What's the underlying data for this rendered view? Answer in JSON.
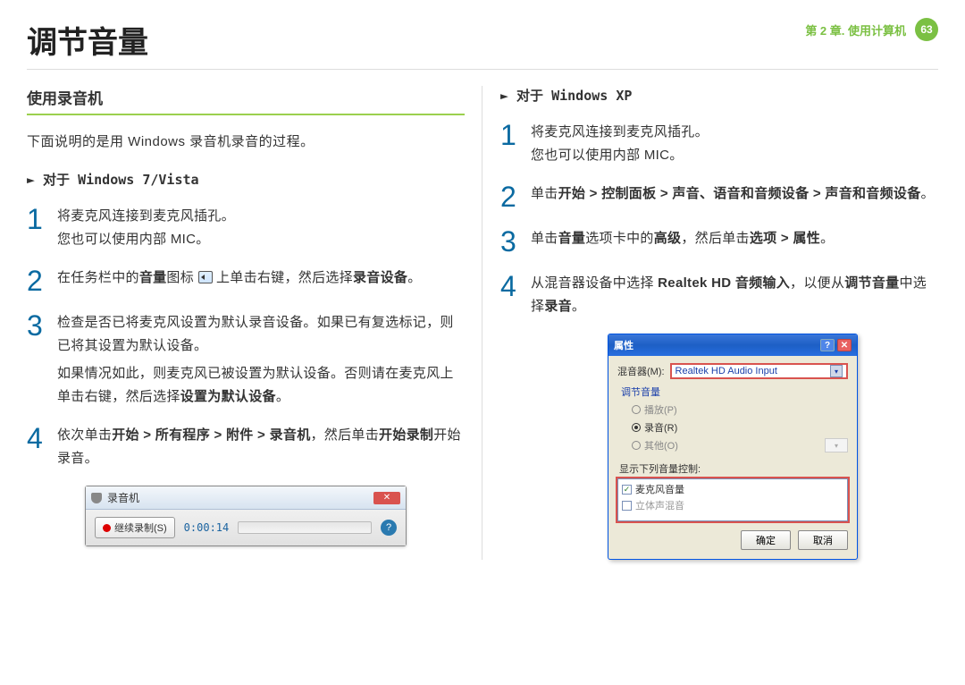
{
  "header": {
    "title": "调节音量",
    "chapter": "第 2 章. 使用计算机",
    "page_num": "63"
  },
  "left": {
    "section_title": "使用录音机",
    "intro": "下面说明的是用 Windows 录音机录音的过程。",
    "sub_title": "► 对于 Windows 7/Vista",
    "steps": {
      "s1a": "将麦克风连接到麦克风插孔。",
      "s1b": "您也可以使用内部 MIC。",
      "s2a": "在任务栏中的",
      "s2b": "音量",
      "s2c": "图标",
      "s2d": "上单击右键，然后选择",
      "s2e": "录音设备",
      "s2f": "。",
      "s3a": "检查是否已将麦克风设置为默认录音设备。如果已有复选标记，则已将其设置为默认设备。",
      "s3b": "如果情况如此，则麦克风已被设置为默认设备。否则请在麦克风上单击右键，然后选择",
      "s3c": "设置为默认设备",
      "s3d": "。",
      "s4a": "依次单击",
      "s4b": "开始 > 所有程序 > 附件 > 录音机",
      "s4c": "，然后单击",
      "s4d": "开始录制",
      "s4e": "开始录音。"
    },
    "recorder": {
      "title": "录音机",
      "btn": "继续录制(S)",
      "time": "0:00:14"
    }
  },
  "right": {
    "sub_title": "► 对于 Windows XP",
    "steps": {
      "s1a": "将麦克风连接到麦克风插孔。",
      "s1b": "您也可以使用内部 MIC。",
      "s2a": "单击",
      "s2b": "开始 > 控制面板 > 声音、语音和音频设备 > 声音和音频设备",
      "s2c": "。",
      "s3a": "单击",
      "s3b": "音量",
      "s3c": "选项卡中的",
      "s3d": "高级",
      "s3e": "，然后单击",
      "s3f": "选项 > 属性",
      "s3g": "。",
      "s4a": "从混音器设备中选择 ",
      "s4b": "Realtek HD 音频输入",
      "s4c": "，以便从",
      "s4d": "调节音量",
      "s4e": "中选择",
      "s4f": "录音",
      "s4g": "。"
    },
    "dialog": {
      "title": "属性",
      "mixer_label": "混音器(M):",
      "mixer_value": "Realtek HD Audio Input",
      "group": "调节音量",
      "radio_play": "播放(P)",
      "radio_rec": "录音(R)",
      "radio_other": "其他(O)",
      "sublabel": "显示下列音量控制:",
      "chk1": "麦克风音量",
      "chk2": "立体声混音",
      "ok": "确定",
      "cancel": "取消"
    }
  }
}
